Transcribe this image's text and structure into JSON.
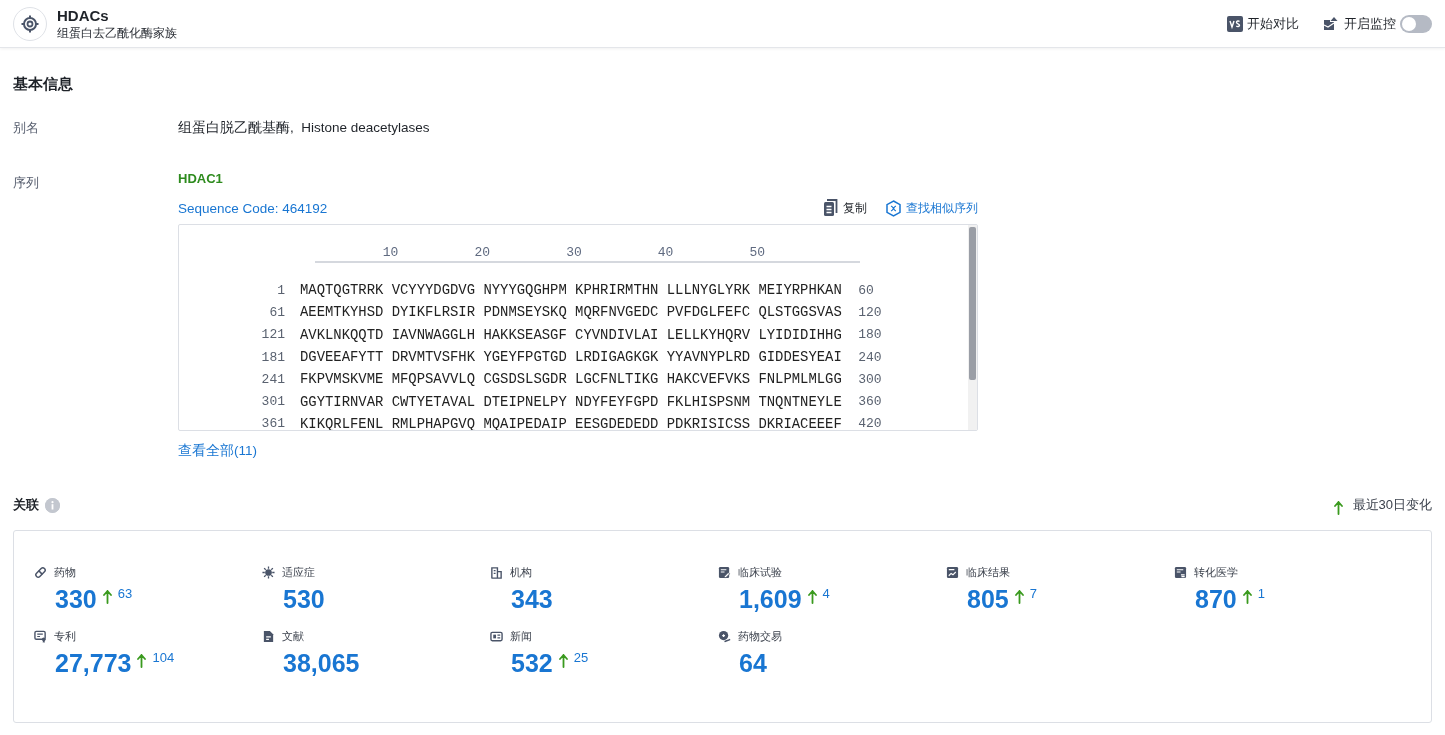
{
  "header": {
    "title": "HDACs",
    "subtitle": "组蛋白去乙酰化酶家族",
    "compare_label": "开始对比",
    "monitor_label": "开启监控",
    "monitor_on": false
  },
  "basic_info": {
    "heading": "基本信息",
    "alias_label": "别名",
    "alias_value": "组蛋白脱乙酰基酶,  Histone deacetylases",
    "sequence_label": "序列",
    "sequence": {
      "name": "HDAC1",
      "code": "Sequence Code: 464192",
      "copy_label": "复制",
      "find_similar_label": "查找相似序列",
      "ruler": [
        "10",
        "20",
        "30",
        "40",
        "50"
      ],
      "rows": [
        {
          "start": "1",
          "groups": [
            "MAQTQGTRRK",
            "VCYYYDGDVG",
            "NYYYGQGHPM",
            "KPHRIRMTHN",
            "LLLNYGLYRK",
            "MEIYRPHKAN"
          ],
          "end": "60"
        },
        {
          "start": "61",
          "groups": [
            "AEEMTKYHSD",
            "DYIKFLRSIR",
            "PDNMSEYSKQ",
            "MQRFNVGEDC",
            "PVFDGLFEFC",
            "QLSTGGSVAS"
          ],
          "end": "120"
        },
        {
          "start": "121",
          "groups": [
            "AVKLNKQQTD",
            "IAVNWAGGLH",
            "HAKKSEASGF",
            "CYVNDIVLAI",
            "LELLKYHQRV",
            "LYIDIDIHHG"
          ],
          "end": "180"
        },
        {
          "start": "181",
          "groups": [
            "DGVEEAFYTT",
            "DRVMTVSFHK",
            "YGEYFPGTGD",
            "LRDIGAGKGK",
            "YYAVNYPLRD",
            "GIDDESYEAI"
          ],
          "end": "240"
        },
        {
          "start": "241",
          "groups": [
            "FKPVMSKVME",
            "MFQPSAVVLQ",
            "CGSDSLSGDR",
            "LGCFNLTIKG",
            "HAKCVEFVKS",
            "FNLPMLMLGG"
          ],
          "end": "300"
        },
        {
          "start": "301",
          "groups": [
            "GGYTIRNVAR",
            "CWTYETAVAL",
            "DTEIPNELPY",
            "NDYFEYFGPD",
            "FKLHISPSNM",
            "TNQNTNEYLE"
          ],
          "end": "360"
        },
        {
          "start": "361",
          "groups": [
            "KIKQRLFENL",
            "RMLPHAPGVQ",
            "MQAIPEDAIP",
            "EESGDEDEDD",
            "PDKRISICSS",
            "DKRIACEEEF"
          ],
          "end": "420"
        }
      ],
      "view_all": "查看全部(11)"
    }
  },
  "related": {
    "heading": "关联",
    "legend": "最近30日变化",
    "stats": [
      {
        "label": "药物",
        "value": "330",
        "delta": "63"
      },
      {
        "label": "适应症",
        "value": "530"
      },
      {
        "label": "机构",
        "value": "343"
      },
      {
        "label": "临床试验",
        "value": "1,609",
        "delta": "4"
      },
      {
        "label": "临床结果",
        "value": "805",
        "delta": "7"
      },
      {
        "label": "转化医学",
        "value": "870",
        "delta": "1"
      },
      {
        "label": "专利",
        "value": "27,773",
        "delta": "104"
      },
      {
        "label": "文献",
        "value": "38,065"
      },
      {
        "label": "新闻",
        "value": "532",
        "delta": "25"
      },
      {
        "label": "药物交易",
        "value": "64"
      }
    ]
  }
}
